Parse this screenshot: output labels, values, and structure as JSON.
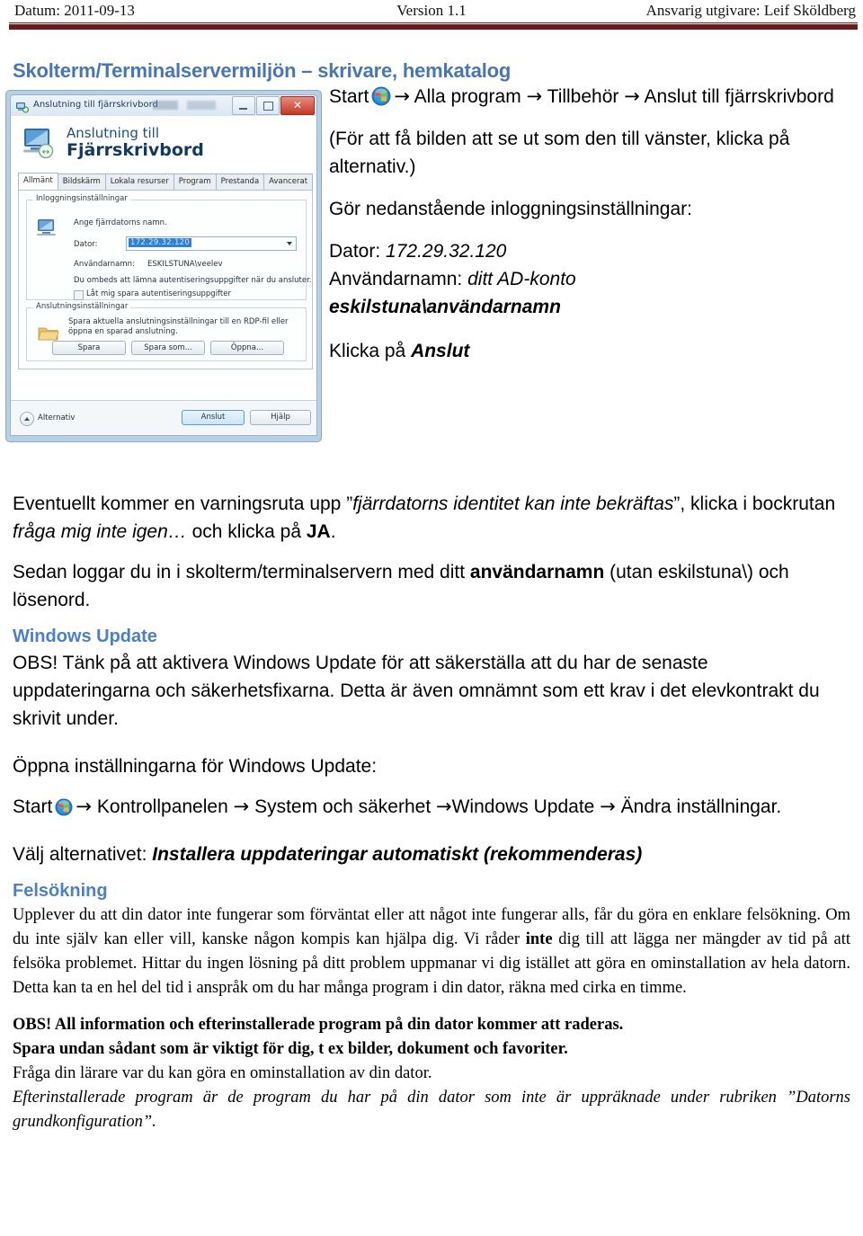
{
  "header": {
    "left": "Datum: 2011-09-13",
    "center": "Version 1.1",
    "right": "Ansvarig utgivare: Leif Sköldberg"
  },
  "section1": {
    "title": "Skolterm/Terminalservermiljön – skrivare, hemkatalog",
    "steps": {
      "start_label": "Start",
      "path_after_orb": "Alla program",
      "path_item2": "Tillbehör",
      "path_item3": "Anslut till fjärrskrivbord",
      "note": "(För att få bilden att se ut som den till vänster, klicka på alternativ.)",
      "settings_intro": "Gör nedanstående inloggningsinställningar:",
      "dator_label": "Dator:",
      "dator_value": "172.29.32.120",
      "anvandarnamn_label": "Användarnamn:",
      "anvandarnamn_value": "ditt AD-konto",
      "anvandarnamn_bold": "eskilstuna\\användarnamn",
      "click_prefix": "Klicka på",
      "click_bold": "Anslut"
    }
  },
  "rdp_dialog": {
    "titlebar": "Anslutning till fjärrskrivbord",
    "minimize_label": "Minimera",
    "maximize_label": "Maximera",
    "close_label": "✕",
    "brand_line1": "Anslutning till",
    "brand_line2": "Fjärrskrivbord",
    "tabs": [
      "Allmänt",
      "Bildskärm",
      "Lokala resurser",
      "Program",
      "Prestanda",
      "Avancerat"
    ],
    "group_login_title": "Inloggningsinställningar",
    "login_hint": "Ange fjärrdatorns namn.",
    "dator_label": "Dator:",
    "dator_value": "172.29.32.120",
    "anvandarnamn_label": "Användarnamn:",
    "anvandarnamn_value": "ESKILSTUNA\\veelev",
    "credentials_note": "Du ombeds att lämna autentiseringsuppgifter när du ansluter.",
    "save_credentials_checkbox": "Låt mig spara autentiseringsuppgifter",
    "group_conn_title": "Anslutningsinställningar",
    "conn_note_line1": "Spara aktuella anslutningsinställningar till en RDP-fil eller",
    "conn_note_line2": "öppna en sparad anslutning.",
    "btn_spara": "Spara",
    "btn_spara_som": "Spara som...",
    "btn_oppna": "Öppna...",
    "alternativ_label": "Alternativ",
    "btn_anslut": "Anslut",
    "btn_hjalp": "Hjälp"
  },
  "warning_paragraph": {
    "p1_a": "Eventuellt kommer en varningsruta upp ”",
    "p1_ital1": "fjärrdatorns identitet kan inte bekräftas",
    "p1_b": "”, klicka i bockrutan ",
    "p1_ital2": "fråga mig inte igen…",
    "p1_c": " och klicka på ",
    "p1_bold": "JA",
    "p1_d": ".",
    "p2_a": "Sedan loggar du in i skolterm/terminalservern med ditt ",
    "p2_bold": "användarnamn",
    "p2_b": " (utan eskilstuna\\) och lösenord."
  },
  "windows_update": {
    "heading": "Windows Update",
    "obs_text": "OBS! Tänk på att aktivera Windows Update för att säkerställa att du har de senaste uppdateringarna och säkerhetsfixarna. Detta är även omnämnt som ett krav i det elevkontrakt du skrivit under.",
    "open_settings": "Öppna inställningarna för Windows Update:",
    "path_start": "Start",
    "path_item1": "Kontrollpanelen",
    "path_item2": "System och säkerhet",
    "path_item3": "Windows Update",
    "path_item4": "Ändra inställningar.",
    "choose_prefix": "Välj alternativet: ",
    "choose_bold": "Installera uppdateringar automatiskt (rekommenderas)"
  },
  "troubleshooting": {
    "heading": "Felsökning",
    "p1_a": "Upplever du att din dator inte fungerar som förväntat eller att något inte fungerar alls, får du göra en enklare felsökning. Om du inte själv kan eller vill, kanske någon kompis kan hjälpa dig. Vi råder ",
    "p1_bold": "inte",
    "p1_b": " dig till att lägga ner mängder av tid på att felsöka problemet. Hittar du ingen lösning på ditt problem uppmanar vi dig istället att göra en ominstallation av hela datorn. Detta kan ta en hel del tid i anspråk om du har många program i din dator, räkna med cirka en timme.",
    "obs_bold_line1": "OBS! All information och efterinstallerade program på din dator kommer att raderas.",
    "obs_bold_line2": "Spara undan sådant som är viktigt för dig, t ex bilder, dokument och favoriter.",
    "ask_teacher": "Fråga din lärare var du kan göra en ominstallation av din dator.",
    "italic_note": "Efterinstallerade program är de program du har på din dator som inte är uppräknade under rubriken ”Datorns grundkonfiguration”."
  },
  "icons": {
    "windows_orb": "windows-start-orb",
    "monitor": "remote-desktop-monitor-icon",
    "folder": "folder-icon",
    "arrow": "→"
  },
  "colors": {
    "heading_blue": "#4876ad",
    "sub_heading_blue": "#4d80bf",
    "header_rule": "#6c1a19"
  }
}
